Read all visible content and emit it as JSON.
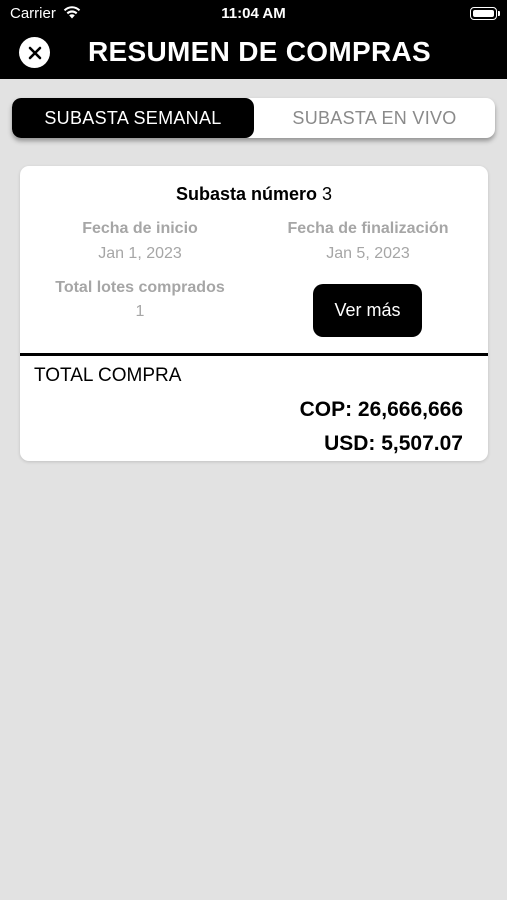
{
  "status_bar": {
    "carrier": "Carrier",
    "time": "11:04 AM"
  },
  "header": {
    "title": "RESUMEN DE COMPRAS",
    "close_icon": "close-icon"
  },
  "tabs": [
    {
      "label": "SUBASTA SEMANAL",
      "active": true
    },
    {
      "label": "SUBASTA EN VIVO",
      "active": false
    }
  ],
  "card": {
    "heading_label": "Subasta número",
    "heading_number": "3",
    "start_label": "Fecha de inicio",
    "start_value": "Jan 1, 2023",
    "end_label": "Fecha de finalización",
    "end_value": "Jan 5, 2023",
    "lots_label": "Total lotes comprados",
    "lots_value": "1",
    "more_button": "Ver más",
    "total_label": "TOTAL COMPRA",
    "total_cop": "COP: 26,666,666",
    "total_usd": "USD: 5,507.07"
  },
  "colors": {
    "header_bg": "#000000",
    "page_bg": "#e2e2e2",
    "muted_text": "#a6a6a6"
  }
}
